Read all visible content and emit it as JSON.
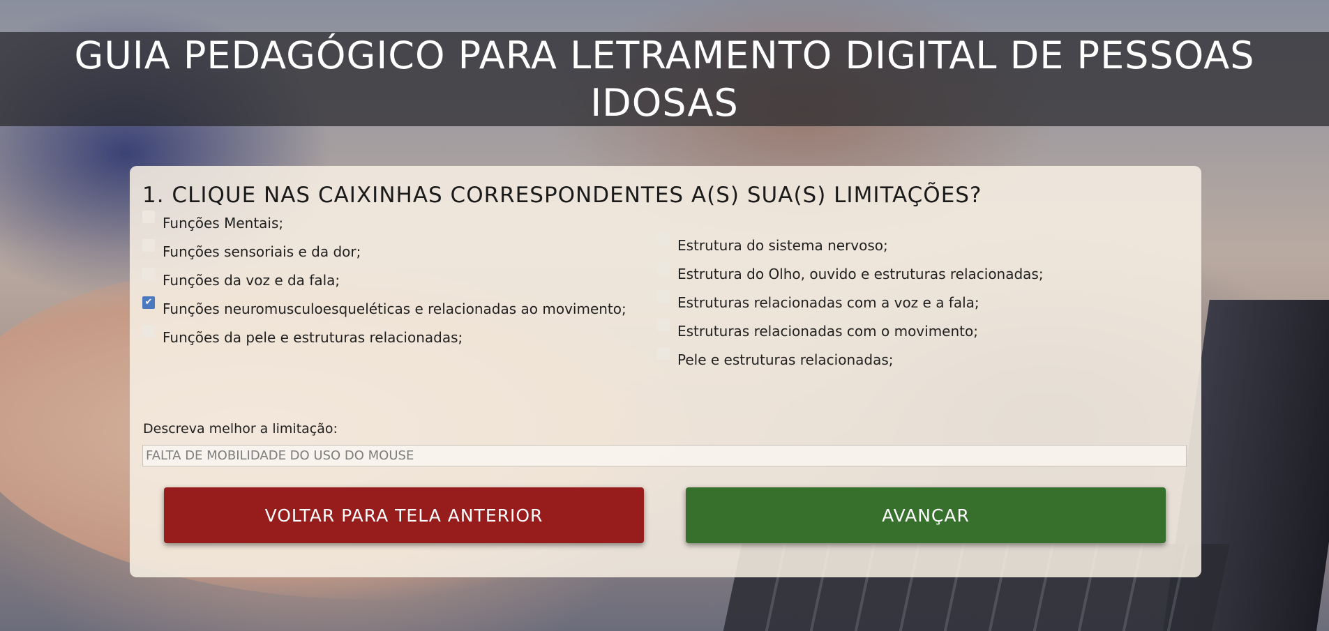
{
  "header": {
    "title": "GUIA PEDAGÓGICO PARA LETRAMENTO DIGITAL DE PESSOAS IDOSAS"
  },
  "form": {
    "question": "1. CLIQUE NAS CAIXINHAS CORRESPONDENTES A(S) SUA(S) LIMITAÇÕES?",
    "left_options": [
      {
        "label": "Funções Mentais;",
        "checked": false
      },
      {
        "label": "Funções sensoriais e da dor;",
        "checked": false
      },
      {
        "label": "Funções da voz e da fala;",
        "checked": false
      },
      {
        "label": "Funções neuromusculoesqueléticas e relacionadas ao movimento;",
        "checked": true
      },
      {
        "label": "Funções da pele e estruturas relacionadas;",
        "checked": false
      }
    ],
    "right_options": [
      {
        "label": "Estrutura do sistema nervoso;",
        "checked": false
      },
      {
        "label": "Estrutura do Olho, ouvido e estruturas relacionadas;",
        "checked": false
      },
      {
        "label": "Estruturas relacionadas com a voz e a fala;",
        "checked": false
      },
      {
        "label": "Estruturas relacionadas com o movimento;",
        "checked": false
      },
      {
        "label": "Pele e estruturas relacionadas;",
        "checked": false
      }
    ],
    "describe_label": "Descreva melhor a limitação:",
    "describe_value": "FALTA DE MOBILIDADE DO USO DO MOUSE"
  },
  "buttons": {
    "back_label": "VOLTAR PARA TELA ANTERIOR",
    "next_label": "AVANÇAR"
  },
  "colors": {
    "back_button": "#971c1c",
    "next_button": "#37702c",
    "checkbox_checked": "#4c78c0"
  },
  "icons": {
    "checked_mark": "checkmark-icon"
  }
}
